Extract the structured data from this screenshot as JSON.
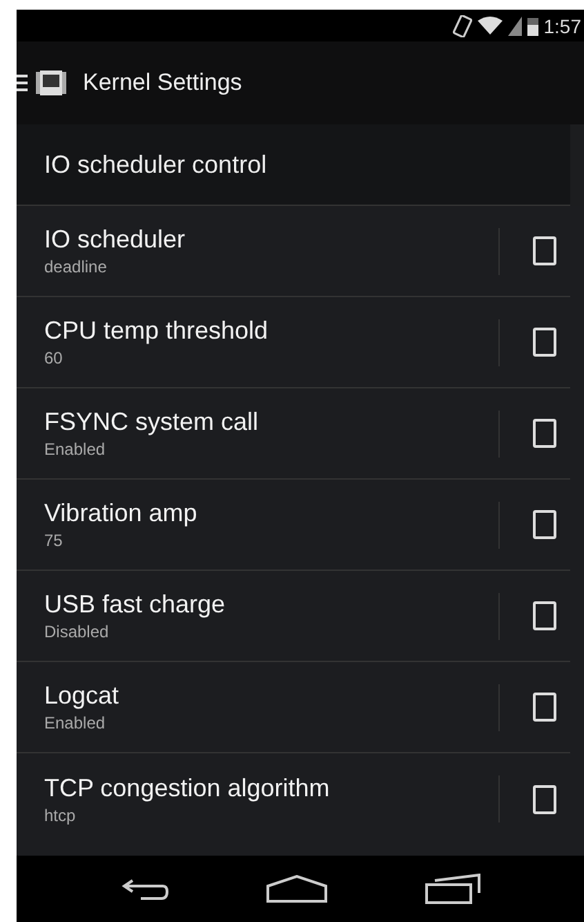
{
  "status_bar": {
    "time": "1:57"
  },
  "action_bar": {
    "title": "Kernel Settings"
  },
  "section": {
    "title": "IO scheduler control"
  },
  "settings": [
    {
      "title": "IO scheduler",
      "summary": "deadline",
      "checked": false
    },
    {
      "title": "CPU temp threshold",
      "summary": "60",
      "checked": false
    },
    {
      "title": "FSYNC system call",
      "summary": "Enabled",
      "checked": false
    },
    {
      "title": "Vibration amp",
      "summary": "75",
      "checked": false
    },
    {
      "title": "USB fast charge",
      "summary": "Disabled",
      "checked": false
    },
    {
      "title": "Logcat",
      "summary": "Enabled",
      "checked": false
    },
    {
      "title": "TCP congestion algorithm",
      "summary": "htcp",
      "checked": false
    }
  ]
}
